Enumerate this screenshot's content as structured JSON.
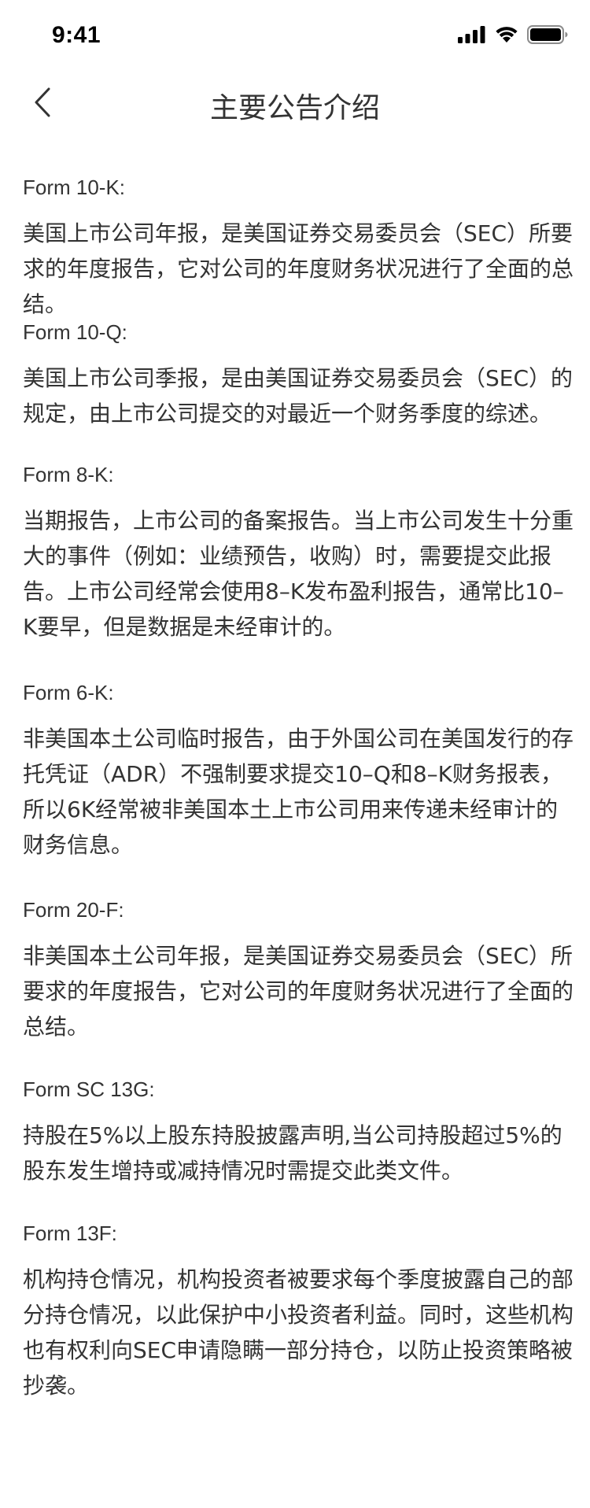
{
  "status_bar": {
    "time": "9:41",
    "icons": [
      "signal-icon",
      "wifi-icon",
      "battery-icon"
    ]
  },
  "nav": {
    "back_icon": "chevron-left-icon",
    "title": "主要公告介绍"
  },
  "forms": [
    {
      "title": "Form 10-K:",
      "desc": "美国上市公司年报，是美国证券交易委员会（SEC）所要求的年度报告，它对公司的年度财务状况进行了全面的总结。"
    },
    {
      "title": "Form 10-Q:",
      "desc": "美国上市公司季报，是由美国证券交易委员会（SEC）的规定，由上市公司提交的对最近一个财务季度的综述。"
    },
    {
      "title": "Form 8-K:",
      "desc": "当期报告，上市公司的备案报告。当上市公司发生十分重大的事件（例如：业绩预告，收购）时，需要提交此报告。上市公司经常会使用8–K发布盈利报告，通常比10–K要早，但是数据是未经审计的。"
    },
    {
      "title": "Form 6-K:",
      "desc": "非美国本土公司临时报告，由于外国公司在美国发行的存托凭证（ADR）不强制要求提交10–Q和8–K财务报表，所以6K经常被非美国本土上市公司用来传递未经审计的财务信息。"
    },
    {
      "title": "Form 20-F:",
      "desc": "非美国本土公司年报，是美国证券交易委员会（SEC）所要求的年度报告，它对公司的年度财务状况进行了全面的总结。"
    },
    {
      "title": "Form SC 13G:",
      "desc": "持股在5%以上股东持股披露声明,当公司持股超过5%的股东发生增持或减持情况时需提交此类文件。"
    },
    {
      "title": "Form 13F:",
      "desc": "机构持仓情况，机构投资者被要求每个季度披露自己的部分持仓情况，以此保护中小投资者利益。同时，这些机构也有权利向SEC申请隐瞒一部分持仓，以防止投资策略被抄袭。"
    }
  ]
}
